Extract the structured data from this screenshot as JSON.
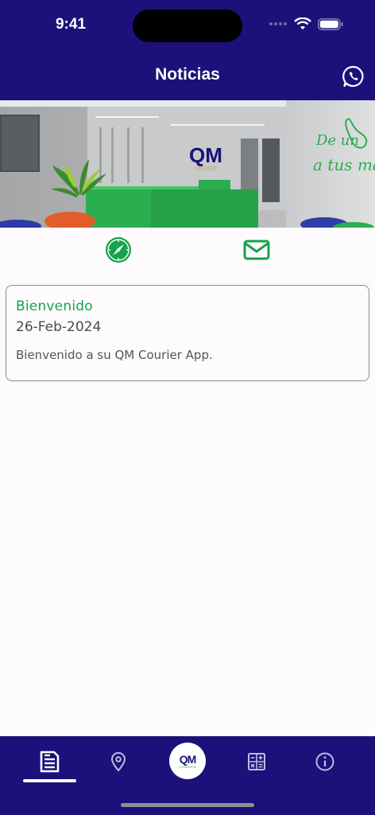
{
  "status_bar": {
    "time": "9:41"
  },
  "header": {
    "title": "Noticias",
    "whatsapp_icon": "whatsapp-icon"
  },
  "banner": {
    "logo_main": "QM",
    "logo_sub": "COURIER",
    "wall_text_1": "De un",
    "wall_text_2": "a tus manos"
  },
  "quick_actions": [
    {
      "icon": "compass-icon"
    },
    {
      "icon": "envelope-icon"
    }
  ],
  "news": [
    {
      "title": "Bienvenido",
      "date": "26-Feb-2024",
      "body": "Bienvenido a su QM Courier App."
    }
  ],
  "tabbar": {
    "tabs": [
      {
        "icon": "news-icon",
        "active": true
      },
      {
        "icon": "location-pin-icon",
        "active": false
      },
      {
        "icon": "qm-logo",
        "active": false,
        "logo_text": "QM",
        "logo_sub": "COURIER"
      },
      {
        "icon": "calculator-icon",
        "active": false
      },
      {
        "icon": "info-icon",
        "active": false
      }
    ]
  },
  "colors": {
    "primary": "#1c117a",
    "accent": "#16a34a"
  }
}
